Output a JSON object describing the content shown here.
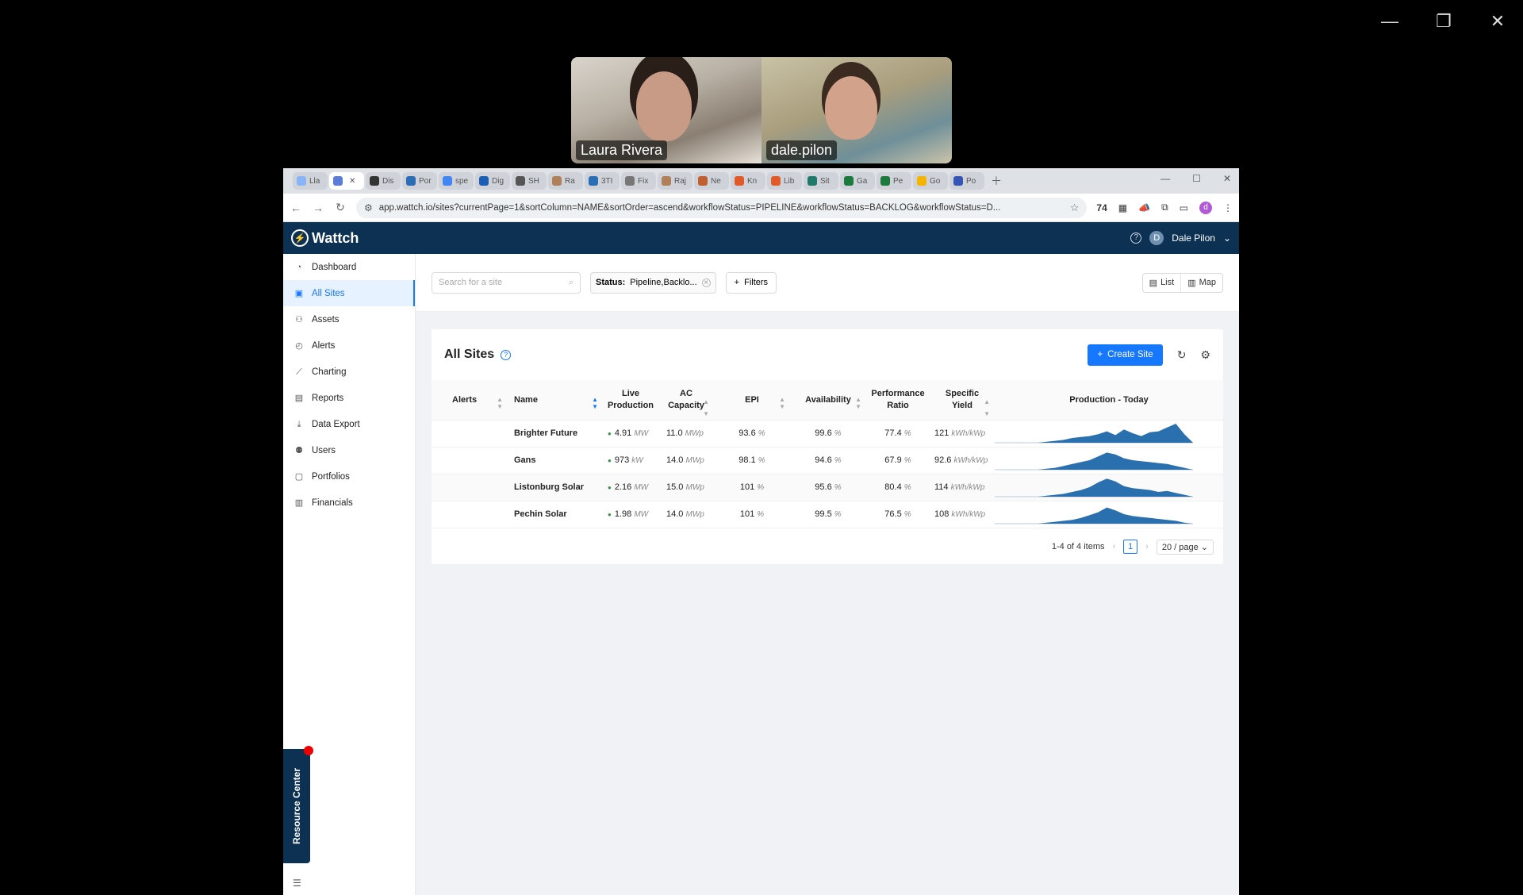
{
  "meeting": {
    "participants": [
      {
        "name": "Laura Rivera"
      },
      {
        "name": "dale.pilon"
      }
    ]
  },
  "browser": {
    "tabs": [
      {
        "label": "Lla",
        "color": "#8ab4f8"
      },
      {
        "label": "",
        "color": "#5a7bd6",
        "active": true
      },
      {
        "label": "Dis",
        "color": "#333333"
      },
      {
        "label": "Por",
        "color": "#2c6db5"
      },
      {
        "label": "spe",
        "color": "#4285f4"
      },
      {
        "label": "Dig",
        "color": "#1a5fb4"
      },
      {
        "label": "SH",
        "color": "#555555"
      },
      {
        "label": "Ra",
        "color": "#b0805a"
      },
      {
        "label": "3TI",
        "color": "#2a6fb5"
      },
      {
        "label": "Fix",
        "color": "#777777"
      },
      {
        "label": "Raj",
        "color": "#b0805a"
      },
      {
        "label": "Ne",
        "color": "#c06030"
      },
      {
        "label": "Kn",
        "color": "#e05a2a"
      },
      {
        "label": "Lib",
        "color": "#e05a2a"
      },
      {
        "label": "Sit",
        "color": "#1f7a6b"
      },
      {
        "label": "Ga",
        "color": "#1d7a3e"
      },
      {
        "label": "Pe",
        "color": "#1d7a3e"
      },
      {
        "label": "Go",
        "color": "#f4b400"
      },
      {
        "label": "Po",
        "color": "#3555b6"
      }
    ],
    "url": "app.wattch.io/sites?currentPage=1&sortColumn=NAME&sortOrder=ascend&workflowStatus=PIPELINE&workflowStatus=BACKLOG&workflowStatus=D...",
    "extension_badge": "74",
    "profile_initial": "d"
  },
  "app": {
    "brand": "Wattch",
    "user_initial": "D",
    "user_name": "Dale Pilon"
  },
  "sidebar": {
    "items": [
      {
        "label": "Dashboard",
        "icon": "dashboard-icon",
        "glyph": "◔"
      },
      {
        "label": "All Sites",
        "icon": "sites-icon",
        "glyph": "▣",
        "active": true
      },
      {
        "label": "Assets",
        "icon": "assets-icon",
        "glyph": "⚇"
      },
      {
        "label": "Alerts",
        "icon": "alerts-icon",
        "glyph": "◴"
      },
      {
        "label": "Charting",
        "icon": "charting-icon",
        "glyph": "⟋"
      },
      {
        "label": "Reports",
        "icon": "reports-icon",
        "glyph": "▤"
      },
      {
        "label": "Data Export",
        "icon": "export-icon",
        "glyph": "⤓"
      },
      {
        "label": "Users",
        "icon": "users-icon",
        "glyph": "⚉"
      },
      {
        "label": "Portfolios",
        "icon": "portfolios-icon",
        "glyph": "▢"
      },
      {
        "label": "Financials",
        "icon": "financials-icon",
        "glyph": "▥"
      }
    ],
    "resource_center": "Resource Center"
  },
  "filters": {
    "search_placeholder": "Search for a site",
    "status_label": "Status:",
    "status_value": "Pipeline,Backlo...",
    "filters_button": "Filters",
    "view_list": "List",
    "view_map": "Map"
  },
  "card": {
    "title": "All Sites",
    "create_button": "Create Site"
  },
  "table": {
    "headers": {
      "alerts": "Alerts",
      "name": "Name",
      "live_1": "Live",
      "live_2": "Production",
      "ac_1": "AC",
      "ac_2": "Capacity",
      "epi": "EPI",
      "availability": "Availability",
      "pr_1": "Performance",
      "pr_2": "Ratio",
      "sy_1": "Specific",
      "sy_2": "Yield",
      "production": "Production - Today"
    },
    "rows": [
      {
        "name": "Brighter Future",
        "live": "4.91",
        "live_unit": "MW",
        "ac": "11.0",
        "ac_unit": "MWp",
        "epi": "93.6",
        "epi_unit": "%",
        "avail": "99.6",
        "avail_unit": "%",
        "pr": "77.4",
        "pr_unit": "%",
        "sy": "121",
        "sy_unit": "kWh/kWp",
        "profile": [
          0,
          0,
          0,
          0,
          0,
          0,
          1,
          2,
          3,
          5,
          6,
          7,
          9,
          12,
          8,
          14,
          10,
          7,
          11,
          12,
          16,
          20,
          9,
          0
        ]
      },
      {
        "name": "Gans",
        "live": "973",
        "live_unit": "kW",
        "ac": "14.0",
        "ac_unit": "MWp",
        "epi": "98.1",
        "epi_unit": "%",
        "avail": "94.6",
        "avail_unit": "%",
        "pr": "67.9",
        "pr_unit": "%",
        "sy": "92.6",
        "sy_unit": "kWh/kWp",
        "profile": [
          0,
          0,
          0,
          0,
          0,
          0,
          1,
          2,
          4,
          6,
          8,
          10,
          14,
          18,
          16,
          12,
          10,
          9,
          8,
          7,
          6,
          4,
          2,
          0
        ]
      },
      {
        "name": "Listonburg Solar",
        "live": "2.16",
        "live_unit": "MW",
        "ac": "15.0",
        "ac_unit": "MWp",
        "epi": "101",
        "epi_unit": "%",
        "avail": "95.6",
        "avail_unit": "%",
        "pr": "80.4",
        "pr_unit": "%",
        "sy": "114",
        "sy_unit": "kWh/kWp",
        "profile": [
          0,
          0,
          0,
          0,
          0,
          0,
          1,
          2,
          3,
          5,
          7,
          10,
          15,
          19,
          16,
          11,
          9,
          8,
          7,
          5,
          6,
          4,
          2,
          0
        ]
      },
      {
        "name": "Pechin Solar",
        "live": "1.98",
        "live_unit": "MW",
        "ac": "14.0",
        "ac_unit": "MWp",
        "epi": "101",
        "epi_unit": "%",
        "avail": "99.5",
        "avail_unit": "%",
        "pr": "76.5",
        "pr_unit": "%",
        "sy": "108",
        "sy_unit": "kWh/kWp",
        "profile": [
          0,
          0,
          0,
          0,
          0,
          0,
          1,
          2,
          3,
          4,
          6,
          9,
          12,
          17,
          14,
          10,
          8,
          7,
          6,
          5,
          4,
          3,
          1,
          0
        ]
      }
    ]
  },
  "pagination": {
    "range": "1-4 of 4 items",
    "page": "1",
    "page_size": "20 / page"
  },
  "colors": {
    "brand_navy": "#0c3153",
    "accent_blue": "#1677ff",
    "spark_fill": "#2a6fae"
  }
}
